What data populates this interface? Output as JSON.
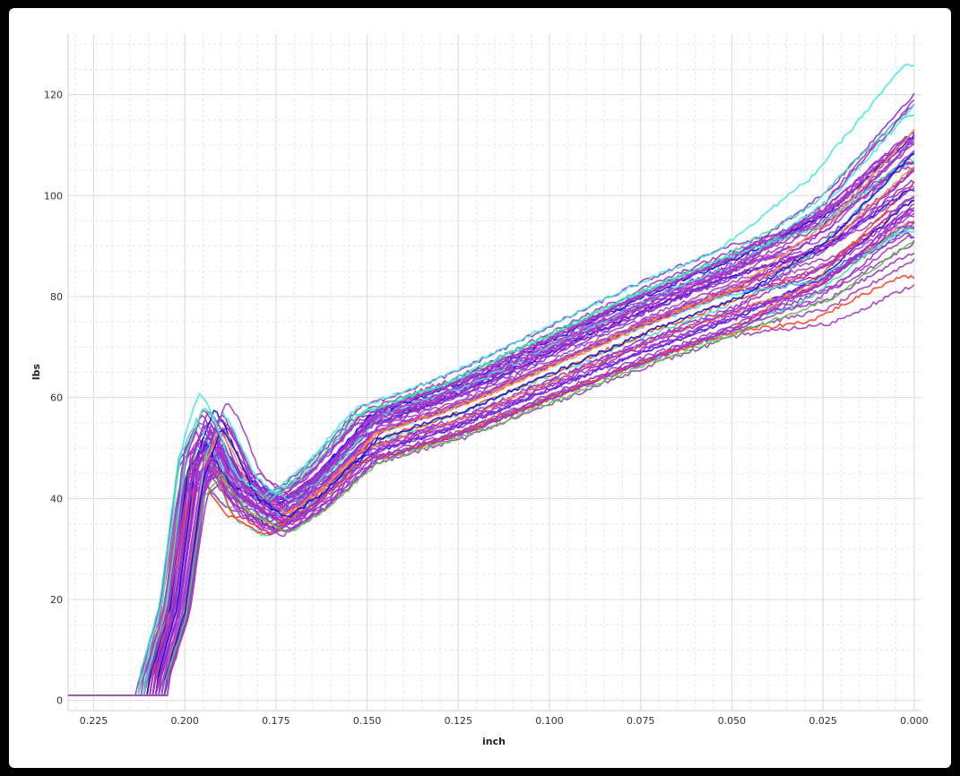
{
  "chart_data": {
    "type": "line",
    "title": "",
    "xlabel": "inch",
    "ylabel": "lbs",
    "xlim": [
      0.232,
      -0.002
    ],
    "ylim": [
      -2,
      132
    ],
    "x_reversed": true,
    "x_ticks": [
      0.225,
      0.2,
      0.175,
      0.15,
      0.125,
      0.1,
      0.075,
      0.05,
      0.025,
      0.0
    ],
    "x_tick_labels": [
      "0.225",
      "0.200",
      "0.175",
      "0.150",
      "0.125",
      "0.100",
      "0.075",
      "0.050",
      "0.025",
      "0.000"
    ],
    "y_ticks": [
      0,
      20,
      40,
      60,
      80,
      100,
      120
    ],
    "y_tick_labels": [
      "0",
      "20",
      "40",
      "60",
      "80",
      "100",
      "120"
    ],
    "grid": true,
    "legend": "none",
    "series_count": 60,
    "palette": [
      "#9b30c8",
      "#8a2be2",
      "#a040c0",
      "#40e0b0",
      "#ff8c40",
      "#ff4020",
      "#1010e0",
      "#40e8e0",
      "#60c050",
      "#b040d0"
    ],
    "representative_curve": {
      "x": [
        0.232,
        0.21,
        0.203,
        0.198,
        0.193,
        0.185,
        0.175,
        0.165,
        0.15,
        0.125,
        0.1,
        0.075,
        0.05,
        0.025,
        0.0
      ],
      "y": [
        1,
        1,
        18,
        45,
        52,
        42,
        37,
        42,
        53,
        59,
        67,
        75,
        82,
        90,
        105
      ]
    }
  }
}
